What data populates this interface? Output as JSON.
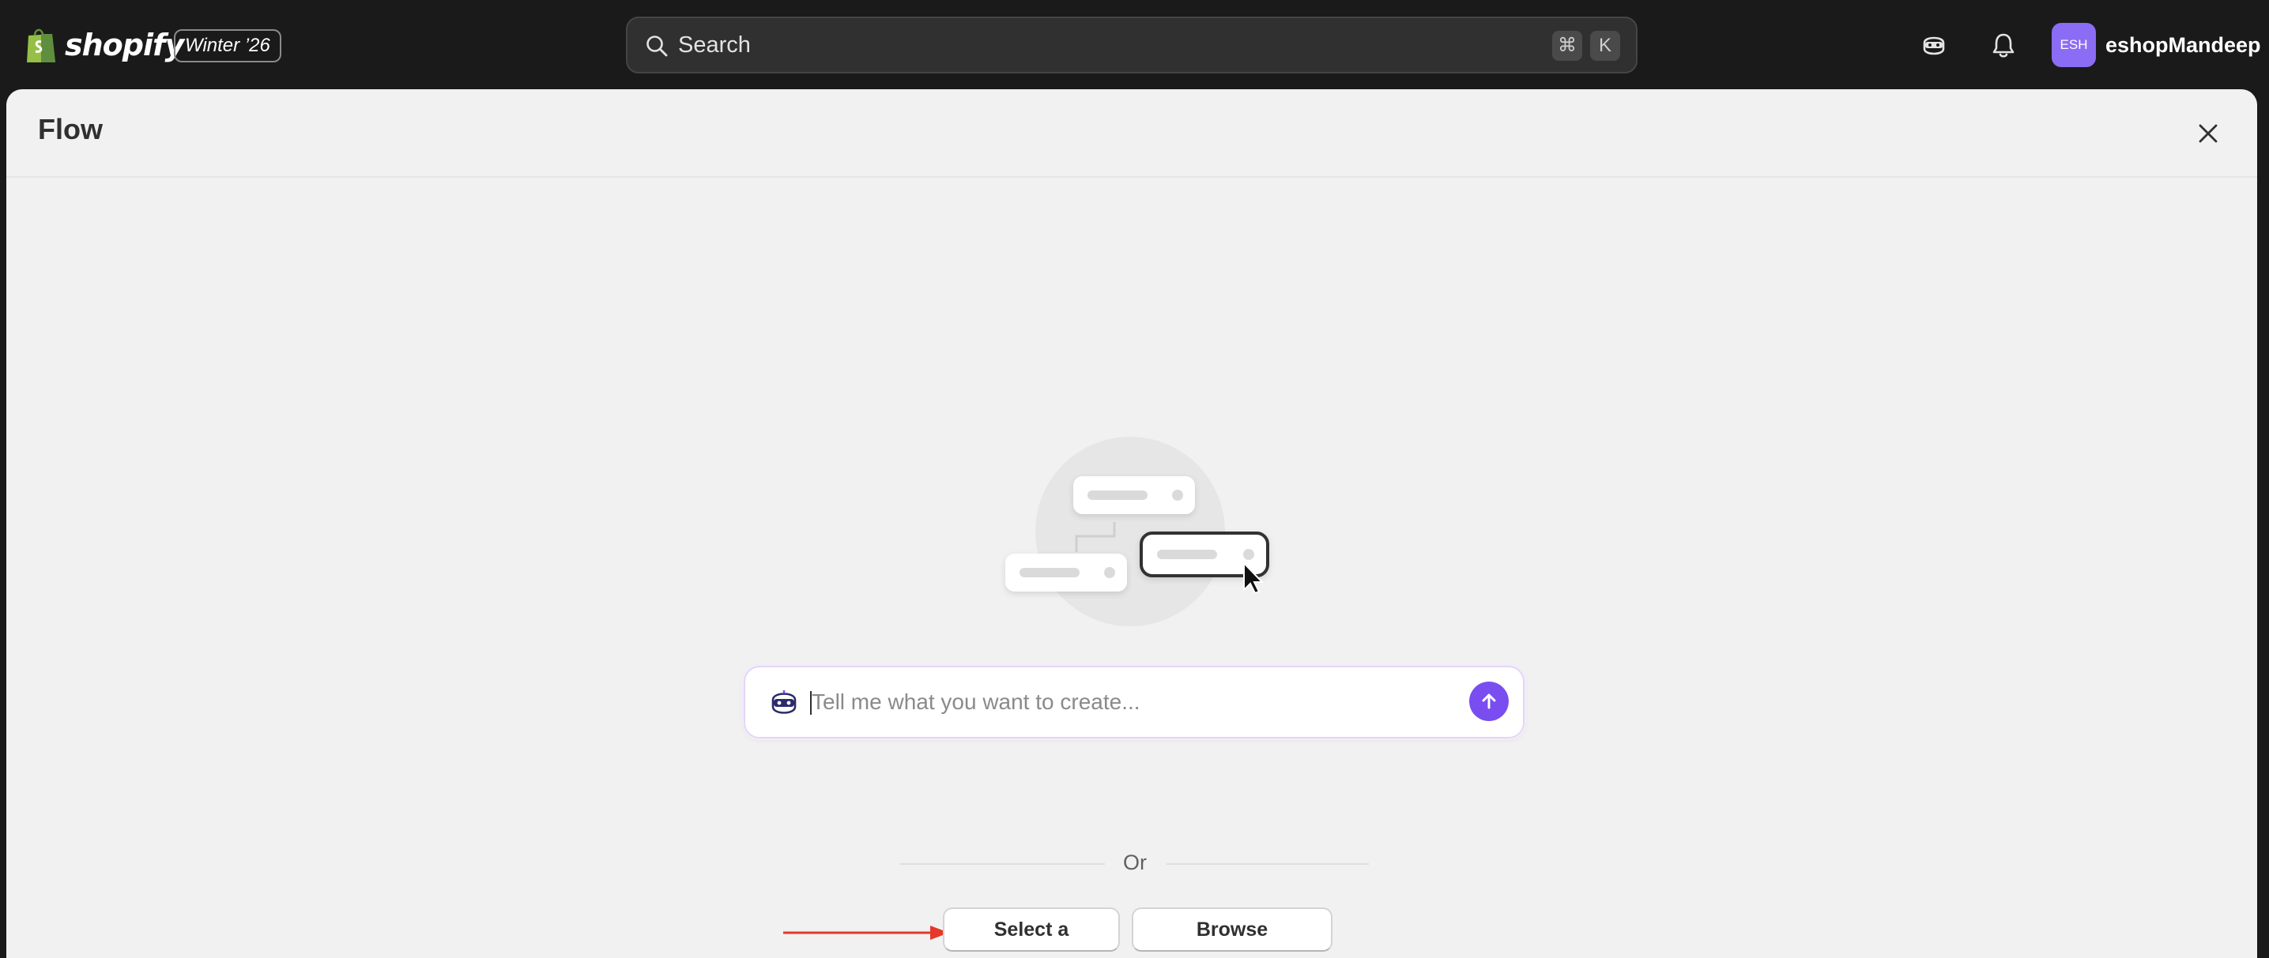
{
  "topbar": {
    "logo_text": "shopify",
    "edition_badge": "Winter ’26",
    "search": {
      "placeholder": "Search",
      "shortcut_cmd": "⌘",
      "shortcut_key": "K"
    },
    "account": {
      "avatar_initials": "ESH",
      "name": "eshopMandeep",
      "avatar_color": "#8b6cf4"
    },
    "icons": [
      "sidekick-icon",
      "bell-icon"
    ]
  },
  "modal": {
    "title": "Flow",
    "prompt": {
      "placeholder": "Tell me what you want to create...",
      "value": ""
    },
    "or_label": "Or",
    "buttons": {
      "select_trigger": "Select a trigger",
      "browse_templates": "Browse templates"
    }
  },
  "colors": {
    "topbar_bg": "#1a1a1a",
    "modal_bg": "#f1f1f1",
    "accent": "#7a4df0",
    "annotation": "#e5382a"
  }
}
